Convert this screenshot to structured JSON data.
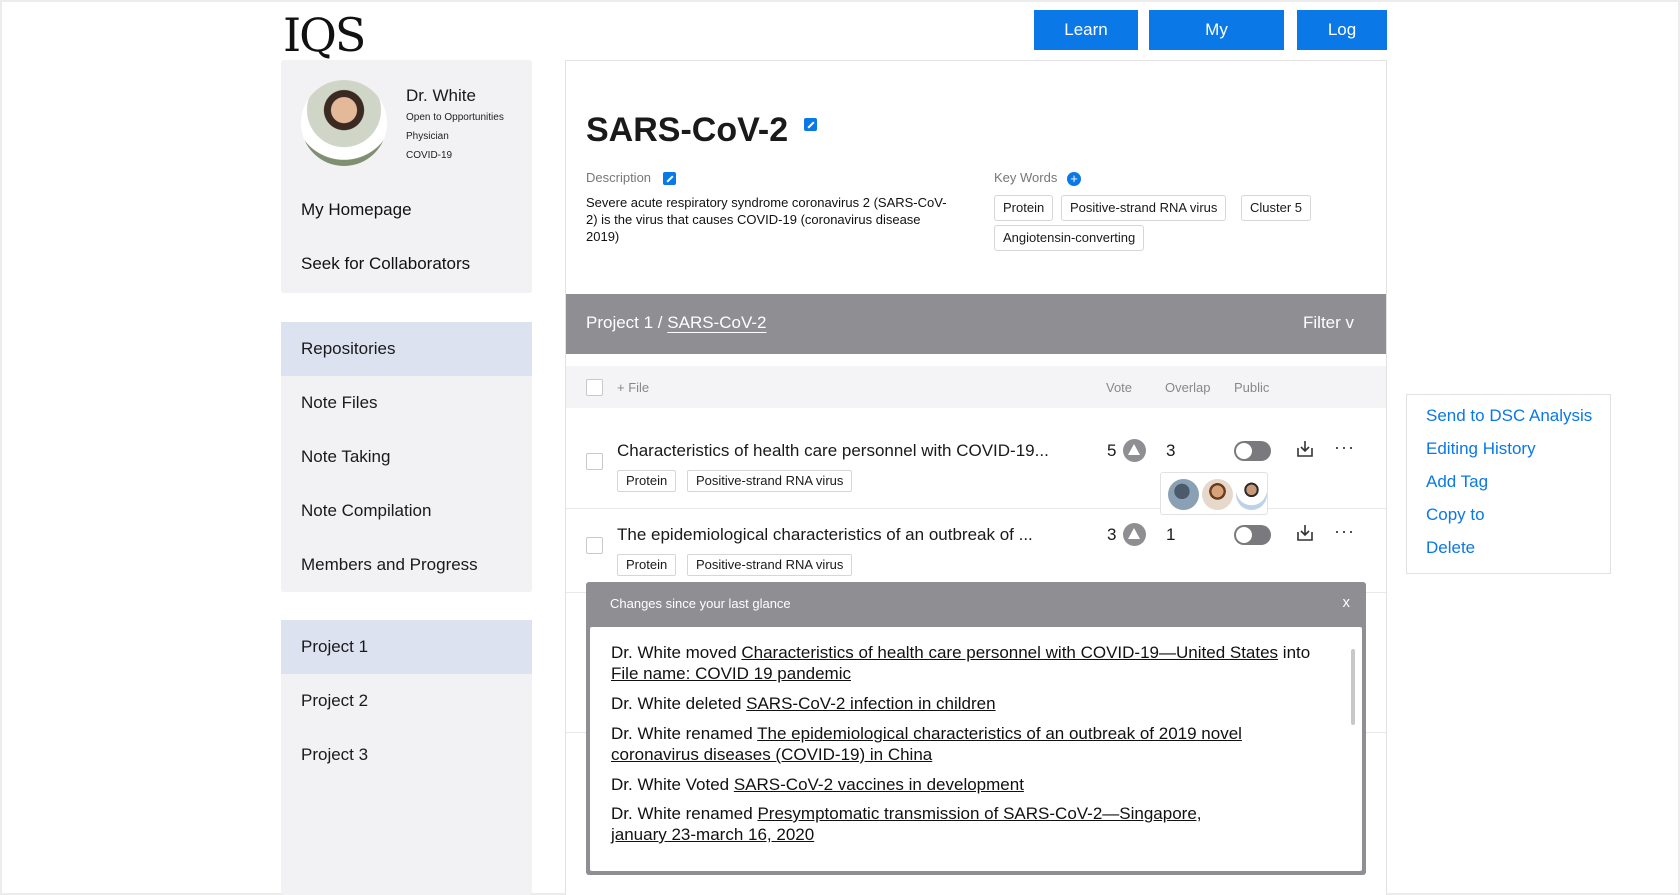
{
  "header": {
    "logo": "IQS",
    "buttons": {
      "learn": "Learn IQS",
      "repository": "My Repository",
      "logout": "Log Out"
    }
  },
  "profile": {
    "name": "Dr. White",
    "lines": [
      "Open to Opportunities",
      "Physician",
      "COVID-19"
    ],
    "links": [
      "My Homepage",
      "Seek for Collaborators"
    ]
  },
  "nav": {
    "items": [
      "Repositories",
      "Note Files",
      "Note Taking",
      "Note Compilation",
      "Members and Progress"
    ],
    "active": "Repositories"
  },
  "projects": {
    "items": [
      "Project 1",
      "Project 2",
      "Project 3"
    ],
    "active": "Project 1"
  },
  "repo": {
    "title": "SARS-CoV-2",
    "description_label": "Description",
    "description": "Severe acute respiratory syndrome coronavirus 2 (SARS-CoV-2) is the virus that causes COVID-19 (coronavirus disease 2019)",
    "keywords_label": "Key Words",
    "keywords": [
      "Protein",
      "Positive-strand RNA virus",
      "Cluster 5",
      "Angiotensin-converting"
    ]
  },
  "bar": {
    "crumb_prefix": "Project 1 / ",
    "crumb_link": "SARS-CoV-2",
    "filter": "Filter v"
  },
  "table": {
    "add_file": "+ File",
    "columns": {
      "vote": "Vote",
      "overlap": "Overlap",
      "public": "Public"
    },
    "rows": [
      {
        "title": "Characteristics of health care personnel with COVID-19...",
        "tags": [
          "Protein",
          "Positive-strand RNA virus"
        ],
        "vote": "5",
        "overlap": "3",
        "public": false
      },
      {
        "title": "The epidemiological characteristics of an outbreak of ...",
        "tags": [
          "Protein",
          "Positive-strand RNA virus"
        ],
        "vote": "3",
        "overlap": "1",
        "public": false
      }
    ],
    "more": "···"
  },
  "context_menu": [
    "Send to DSC Analysis",
    "Editing History",
    "Add Tag",
    "Copy to",
    "Delete"
  ],
  "changes": {
    "title": "Changes since your last glance",
    "close": "x",
    "items": [
      {
        "pre": "Dr. White moved ",
        "link": "Characteristics of health care personnel with COVID-19—United States",
        "mid": " into ",
        "link2": "File name: COVID 19 pandemic"
      },
      {
        "pre": "Dr. White deleted ",
        "link": "SARS-CoV-2 infection in children"
      },
      {
        "pre": "Dr. White renamed ",
        "link": "The epidemiological characteristics of an outbreak of 2019 novel coronavirus diseases (COVID-19) in China"
      },
      {
        "pre": "Dr. White Voted ",
        "link": "SARS-CoV-2 vaccines in development"
      },
      {
        "pre": "Dr. White renamed ",
        "link": "Presymptomatic transmission of SARS-CoV-2—Singapore, january 23-march 16, 2020"
      }
    ]
  },
  "colors": {
    "accent": "#0a78e6",
    "bar": "#8e8e93",
    "active_nav": "#dce2f0",
    "panel": "#f2f2f4"
  }
}
